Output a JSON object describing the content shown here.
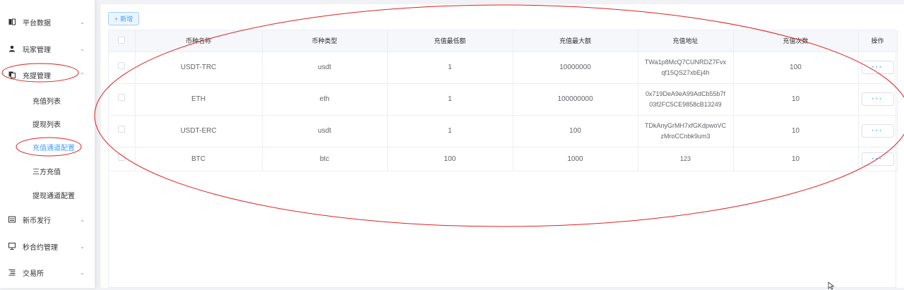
{
  "sidebar": {
    "items": [
      {
        "label": "平台数据",
        "icon": "book-icon",
        "chevron": "⌄"
      },
      {
        "label": "玩家管理",
        "icon": "user-icon",
        "chevron": "⌄"
      },
      {
        "label": "充提管理",
        "icon": "copy-icon",
        "chevron": "⌃"
      },
      {
        "label": "新币发行",
        "icon": "document-icon",
        "chevron": "⌄"
      },
      {
        "label": "秒合约管理",
        "icon": "monitor-icon",
        "chevron": "⌄"
      },
      {
        "label": "交易所",
        "icon": "list-icon",
        "chevron": "⌄"
      }
    ],
    "subitems": [
      {
        "label": "充值列表"
      },
      {
        "label": "提现列表"
      },
      {
        "label": "充值通道配置",
        "active": true
      },
      {
        "label": "三方充值"
      },
      {
        "label": "提现通道配置"
      }
    ]
  },
  "toolbar": {
    "add_label": "新增",
    "add_icon": "+"
  },
  "table": {
    "headers": [
      "币种名称",
      "币种类型",
      "充值最低额",
      "充值最大额",
      "充值地址",
      "充值次数",
      "操作"
    ],
    "rows": [
      {
        "name": "USDT-TRC",
        "type": "usdt",
        "min": "1",
        "max": "10000000",
        "address": "TWa1p8McQ7CUNRDZ7Fvxqf15QS27xbEj4h",
        "count": "100",
        "ops": "···"
      },
      {
        "name": "ETH",
        "type": "eth",
        "min": "1",
        "max": "100000000",
        "address": "0x719DeA9eA99AdCb55b7f03f2FC5CE9858cB13249",
        "count": "10",
        "ops": "···"
      },
      {
        "name": "USDT-ERC",
        "type": "usdt",
        "min": "1",
        "max": "100",
        "address": "TDkAnyGrMH7xfGKdpwoVCzMroCCnbk9um3",
        "count": "10",
        "ops": "···"
      },
      {
        "name": "BTC",
        "type": "btc",
        "min": "100",
        "max": "1000",
        "address": "123",
        "count": "10",
        "ops": "···"
      }
    ]
  },
  "colors": {
    "accent": "#409eff",
    "annotation": "#e02020"
  }
}
